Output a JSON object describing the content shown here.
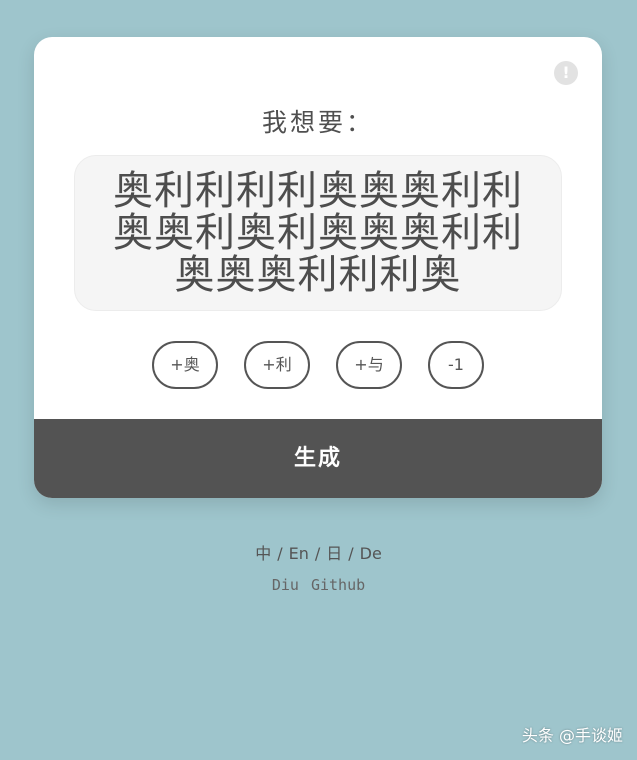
{
  "card": {
    "info_label": "!",
    "heading": "我想要：",
    "display_text": "奥利利利利奥奥奥利利奥奥利奥利奥奥奥利利奥奥奥利利利奥",
    "buttons": {
      "add_ao": "+奥",
      "add_li": "+利",
      "add_yu": "+与",
      "minus_one": "-1"
    },
    "generate_label": "生成"
  },
  "footer": {
    "languages": [
      "中",
      "En",
      "日",
      "De"
    ],
    "separator": "/",
    "links": [
      "Diu",
      "Github"
    ]
  },
  "watermark": "头条 @手谈姬",
  "colors": {
    "background": "#9ec5cc",
    "card": "#ffffff",
    "generate_bar": "#535353",
    "display_box": "#f5f5f5"
  }
}
